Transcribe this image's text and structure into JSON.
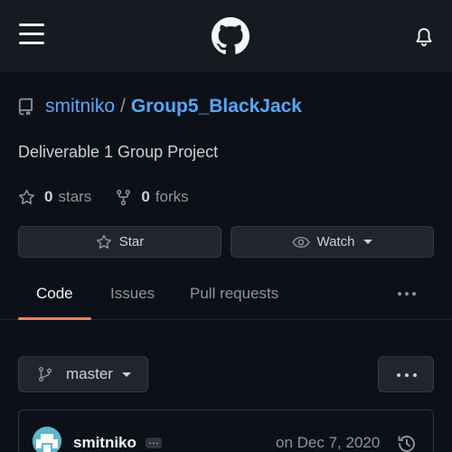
{
  "header": {
    "menu_icon": "hamburger-menu-icon",
    "logo_icon": "github-logo-icon",
    "notifications_icon": "bell-icon"
  },
  "repo": {
    "owner": "smitniko",
    "separator": "/",
    "name": "Group5_BlackJack",
    "description": "Deliverable 1 Group Project"
  },
  "stats": {
    "stars_count": "0",
    "stars_label": "stars",
    "forks_count": "0",
    "forks_label": "forks"
  },
  "actions": {
    "star_label": "Star",
    "watch_label": "Watch"
  },
  "tabs": [
    {
      "label": "Code",
      "selected": true
    },
    {
      "label": "Issues",
      "selected": false
    },
    {
      "label": "Pull requests",
      "selected": false
    }
  ],
  "branch": {
    "name": "master"
  },
  "latest_commit": {
    "author": "smitniko",
    "ellipsis": "…",
    "date": "on Dec 7, 2020"
  },
  "colors": {
    "background": "#0d1117",
    "header": "#161b22",
    "link": "#58a6ff",
    "selected_tab_underline": "#f78166"
  }
}
